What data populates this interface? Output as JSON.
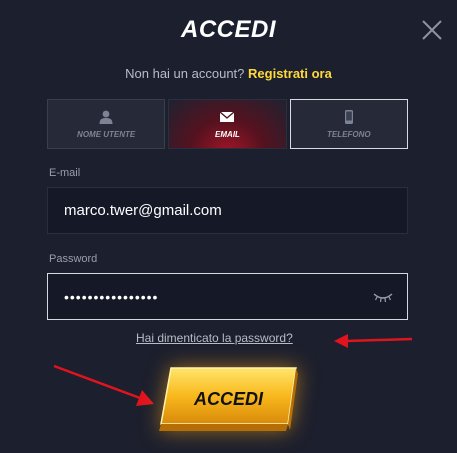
{
  "modal": {
    "title": "ACCEDI",
    "signup_prompt": "Non hai un account?",
    "signup_link": "Registrati ora"
  },
  "tabs": [
    {
      "label": "NOME UTENTE",
      "icon": "user-icon",
      "active": false
    },
    {
      "label": "EMAIL",
      "icon": "envelope-icon",
      "active": true
    },
    {
      "label": "TELEFONO",
      "icon": "phone-icon",
      "active": false
    }
  ],
  "form": {
    "email_label": "E-mail",
    "email_value": "marco.twer@gmail.com",
    "password_label": "Password",
    "password_value": "••••••••••••••••",
    "password_toggle_icon": "eye-closed-icon",
    "forgot_link": "Hai dimenticato la password?",
    "submit_label": "ACCEDI"
  },
  "colors": {
    "background": "#1c1f2d",
    "accent_yellow": "#ffd93b",
    "annotation_red": "#e0141e",
    "active_tab": "#a11527",
    "button_gold": "#f6b31c"
  }
}
